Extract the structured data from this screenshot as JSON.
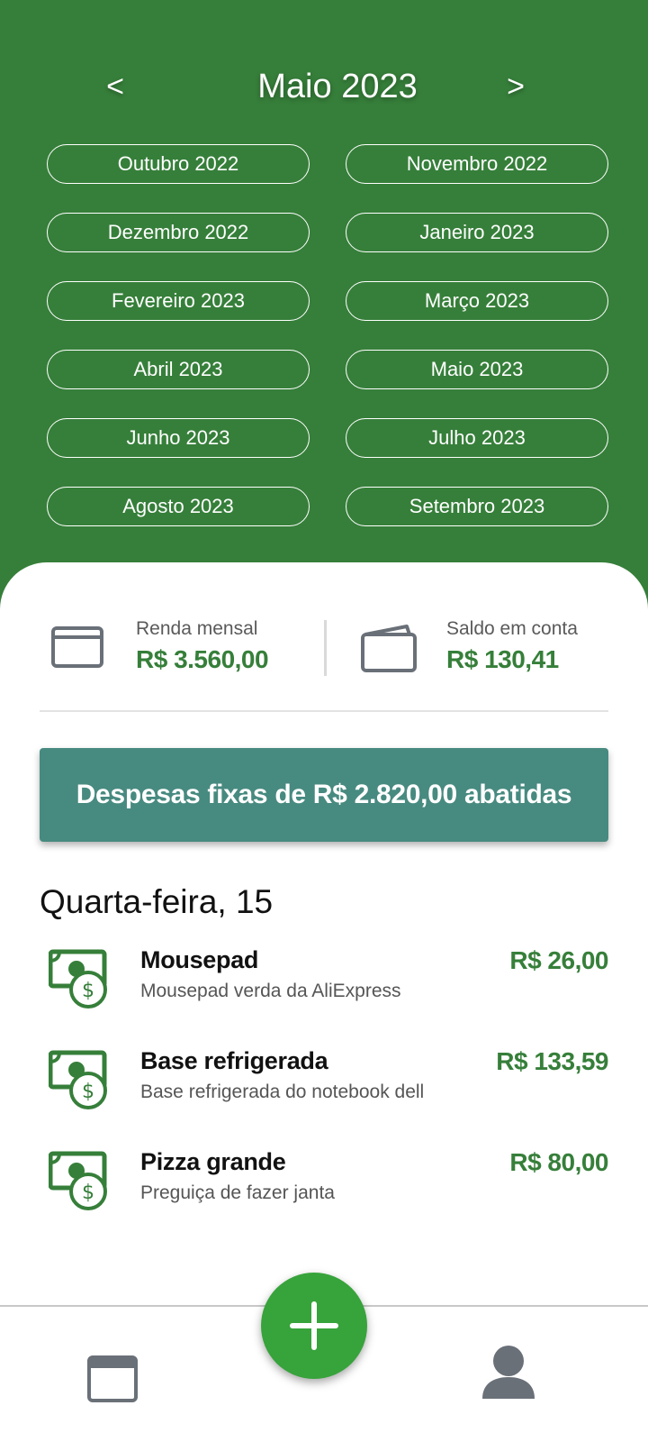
{
  "header": {
    "title": "Maio 2023",
    "prev_label": "<",
    "next_label": ">"
  },
  "months": [
    "Outubro 2022",
    "Novembro 2022",
    "Dezembro 2022",
    "Janeiro 2023",
    "Fevereiro 2023",
    "Março 2023",
    "Abril 2023",
    "Maio 2023",
    "Junho 2023",
    "Julho 2023",
    "Agosto 2023",
    "Setembro 2023"
  ],
  "summary": {
    "income": {
      "label": "Renda mensal",
      "value": "R$ 3.560,00",
      "icon": "card-icon"
    },
    "balance": {
      "label": "Saldo em conta",
      "value": "R$ 130,41",
      "icon": "wallet-icon"
    }
  },
  "fixed_expenses_banner": "Despesas fixas de R$ 2.820,00 abatidas",
  "day_heading": "Quarta-feira, 15",
  "transactions": [
    {
      "title": "Mousepad",
      "description": "Mousepad verda da AliExpress",
      "amount": "R$ 26,00",
      "icon": "money-icon"
    },
    {
      "title": "Base refrigerada",
      "description": "Base refrigerada do notebook dell",
      "amount": "R$ 133,59",
      "icon": "money-icon"
    },
    {
      "title": "Pizza grande",
      "description": "Preguiça de fazer janta",
      "amount": "R$ 80,00",
      "icon": "money-icon"
    }
  ],
  "bottom_nav": {
    "left_icon": "calendar-icon",
    "center_icon": "plus-icon",
    "right_icon": "user-icon"
  },
  "colors": {
    "header_green": "#367f3a",
    "amount_green": "#367f3a",
    "banner_teal": "#478a80",
    "fab_green": "#37a33b",
    "icon_gray": "#6a7078"
  }
}
